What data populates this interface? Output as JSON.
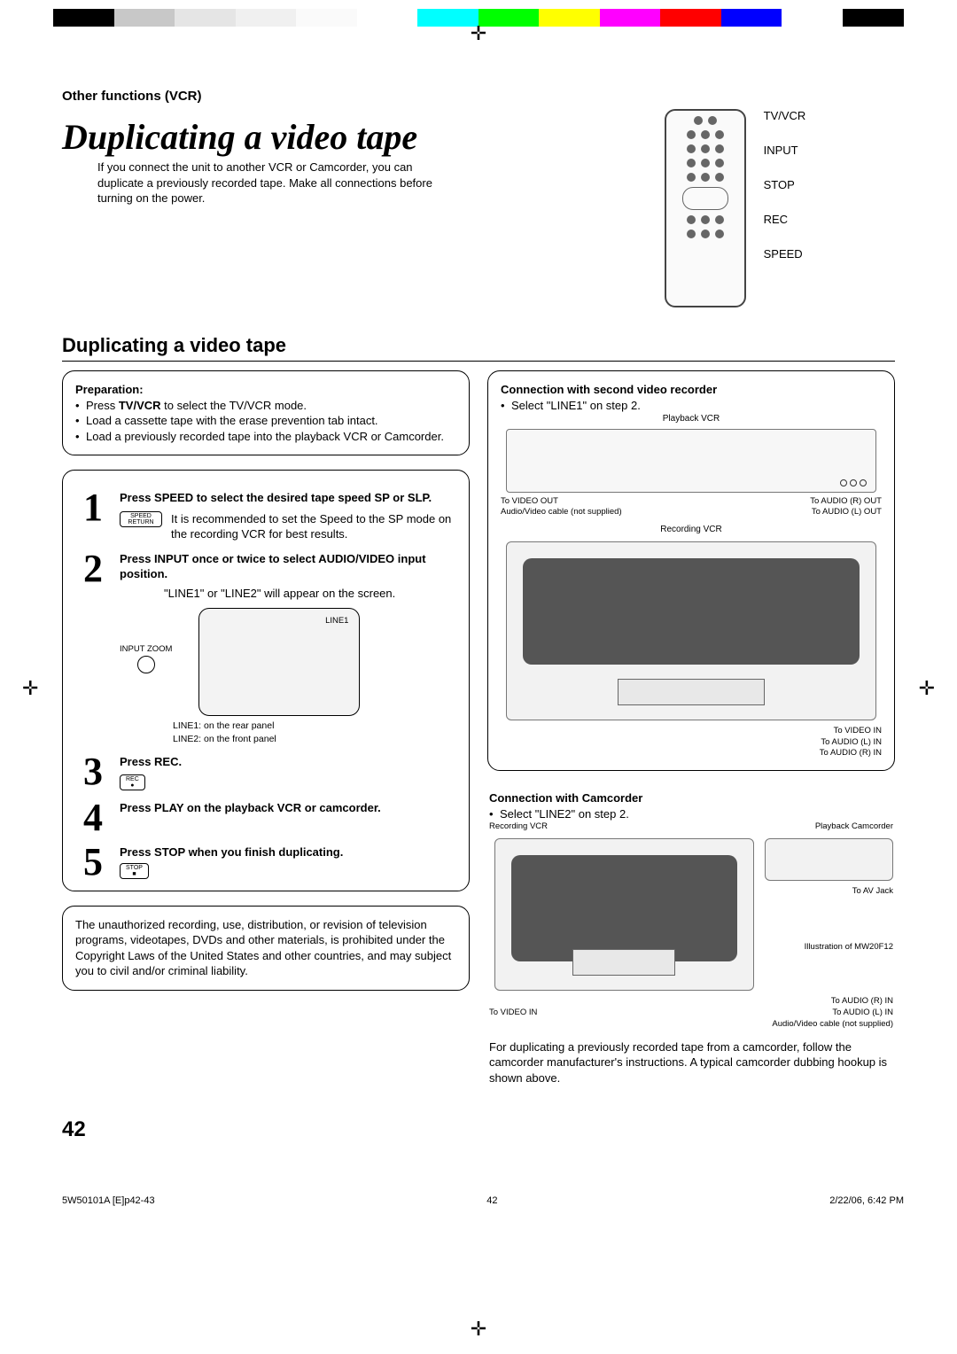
{
  "header": {
    "section_label": "Other functions (VCR)",
    "title": "Duplicating a video tape",
    "intro": "If you connect the unit to another VCR or Camcorder, you can duplicate a previously recorded tape. Make all connections before turning on the power."
  },
  "remote_labels": {
    "tvvcr": "TV/VCR",
    "input": "INPUT",
    "stop": "STOP",
    "rec": "REC",
    "speed": "SPEED"
  },
  "subheading": "Duplicating a video tape",
  "preparation": {
    "title": "Preparation:",
    "item1a": "Press ",
    "item1b": "TV/VCR",
    "item1c": " to select the TV/VCR mode.",
    "item2": "Load a cassette tape with the erase prevention tab intact.",
    "item3": "Load a previously recorded tape into the playback VCR or Camcorder."
  },
  "steps": {
    "s1": {
      "num": "1",
      "head": "Press SPEED to select the desired tape speed SP or SLP.",
      "body": "It is recommended to set the Speed to the SP mode on the recording VCR for best results.",
      "icon": "SPEED RETURN"
    },
    "s2": {
      "num": "2",
      "head": "Press INPUT once or twice to select AUDIO/VIDEO input position.",
      "body": "\"LINE1\" or \"LINE2\" will appear on the screen.",
      "line1_caption": "LINE1",
      "input_icon": "INPUT ZOOM",
      "line_defs1": "LINE1: on the rear panel",
      "line_defs2": "LINE2: on the front panel"
    },
    "s3": {
      "num": "3",
      "head": "Press REC.",
      "icon": "REC"
    },
    "s4": {
      "num": "4",
      "head": "Press PLAY on the playback VCR or camcorder."
    },
    "s5": {
      "num": "5",
      "head": "Press STOP when you finish duplicating.",
      "icon": "STOP"
    }
  },
  "disclaimer": "The unauthorized recording, use, distribution, or revision of television programs, videotapes, DVDs and other materials, is prohibited under the Copyright Laws of the United States and other countries, and may subject you to civil and/or criminal liability.",
  "right": {
    "conn_vcr_title": "Connection with second video recorder",
    "conn_vcr_note": "Select \"LINE1\" on step 2.",
    "playback_vcr_label": "Playback VCR",
    "to_video_out": "To VIDEO OUT",
    "to_audio_r_out": "To AUDIO (R) OUT",
    "to_audio_l_out": "To AUDIO (L) OUT",
    "av_cable": "Audio/Video cable (not supplied)",
    "recording_vcr_label": "Recording VCR",
    "to_video_in": "To VIDEO IN",
    "to_audio_l_in": "To AUDIO (L) IN",
    "to_audio_r_in": "To AUDIO (R) IN",
    "conn_cam_title": "Connection with Camcorder",
    "conn_cam_note": "Select \"LINE2\" on step 2.",
    "playback_cam_label": "Playback Camcorder",
    "to_av_jack": "To AV Jack",
    "illustr": "Illustration of MW20F12",
    "cam_note": "For duplicating a previously recorded tape from a camcorder, follow the camcorder manufacturer's instructions. A typical camcorder dubbing hookup is shown above."
  },
  "page_number": "42",
  "footer": {
    "file": "5W50101A [E]p42-43",
    "pg": "42",
    "date": "2/22/06, 6:42 PM"
  },
  "colorbar": [
    "#000",
    "#c8c8c8",
    "#e5e5e5",
    "#f0f0f0",
    "#fafafa",
    "#fff",
    "#0ff",
    "#0f0",
    "#ff0",
    "#f0f",
    "#f00",
    "#00f",
    "#fff",
    "#000"
  ]
}
